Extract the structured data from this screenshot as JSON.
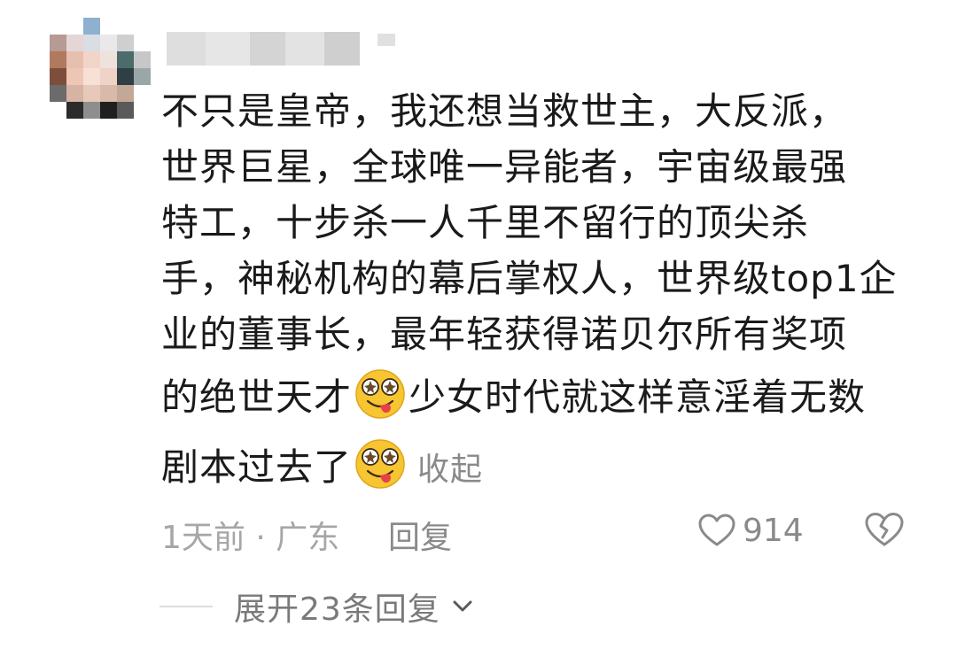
{
  "comment": {
    "text_lines": [
      "不只是皇帝，我还想当救世主，大反派，",
      "世界巨星，全球唯一异能者，宇宙级最强",
      "特工，十步杀一人千里不留行的顶尖杀",
      "手，神秘机构的幕后掌权人，世界级top1企",
      "业的董事长，最年轻获得诺贝尔所有奖项"
    ],
    "line6_before_emoji": "的绝世天才",
    "line6_after_emoji": "少女时代就这样意淫着无数",
    "line7_before_emoji": "剧本过去了",
    "emoji_name": "drooling-face-emoji",
    "collapse_label": "收起"
  },
  "meta": {
    "time_location": "1天前 · 广东",
    "reply_label": "回复",
    "like_count": "914"
  },
  "replies": {
    "expand_label": "展开23条回复"
  },
  "colors": {
    "text": "#1a1a1a",
    "muted": "#a6a6a6",
    "secondary": "#8a8a8a",
    "emoji_yellow": "#f7c531"
  }
}
